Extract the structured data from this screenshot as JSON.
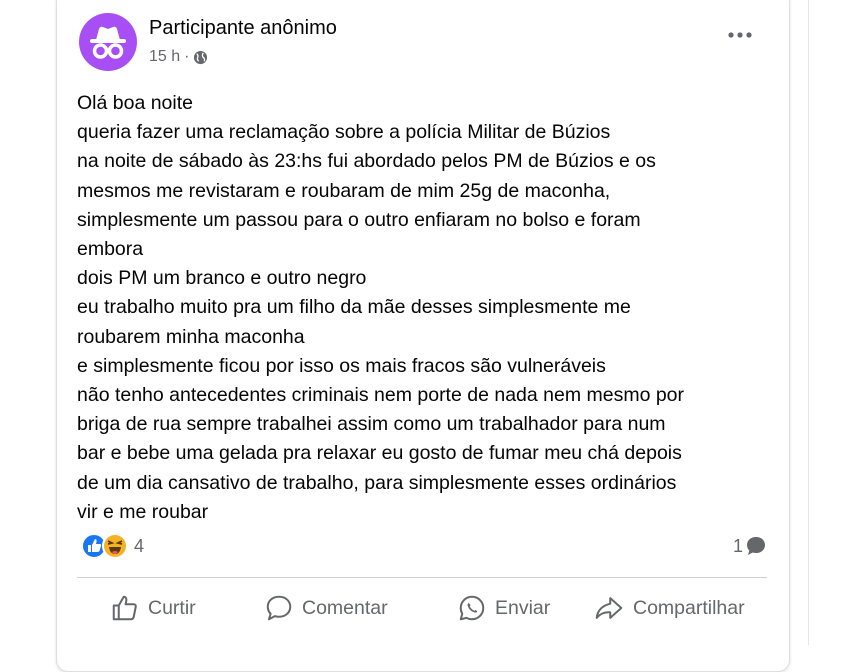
{
  "post": {
    "author": "Participante anônimo",
    "time": "15 h",
    "separator": "·",
    "audience_icon": "globe-icon",
    "more_icon": "more-options-icon",
    "lines": [
      "Olá boa noite",
      "queria fazer uma reclamação sobre a polícia Militar de Búzios",
      "na noite de sábado às 23:hs fui abordado pelos PM de Búzios e os",
      "mesmos me revistaram e roubaram de mim 25g de maconha,",
      "simplesmente um passou para o outro enfiaram no bolso e foram",
      "embora",
      "dois PM um branco e outro negro",
      "eu trabalho muito pra um filho da mãe desses simplesmente me",
      "roubarem minha maconha",
      "e simplesmente ficou por isso os mais fracos são vulneráveis",
      "não tenho antecedentes criminais nem porte de nada nem mesmo por",
      "briga de rua sempre trabalhei assim como um trabalhador para num",
      "bar e bebe uma gelada pra relaxar eu gosto de fumar meu chá depois",
      "de um dia cansativo de trabalho, para simplesmente esses ordinários",
      "vir e me roubar"
    ]
  },
  "reactions": {
    "count": "4",
    "icons": [
      "like-icon",
      "haha-icon"
    ]
  },
  "comments": {
    "count": "1",
    "icon": "comment-bubble-icon"
  },
  "actions": {
    "like": "Curtir",
    "comment": "Comentar",
    "send": "Enviar",
    "share": "Compartilhar"
  },
  "colors": {
    "avatar_bg": "#a74ff5",
    "like_blue": "#1877f2",
    "haha_yellow": "#f7b125",
    "muted": "#65676b",
    "text": "#050505"
  }
}
